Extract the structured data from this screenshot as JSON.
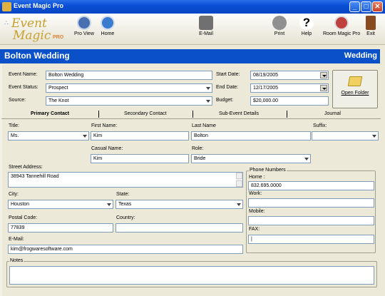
{
  "window": {
    "title": "Event Magic Pro"
  },
  "logo": {
    "line1": "Event",
    "line2": "Magic",
    "badge": "PRO"
  },
  "toolbar": {
    "pro_view": "Pro View",
    "home": "Home",
    "email": "E-Mail",
    "print": "Print",
    "help": "Help",
    "room_magic": "Room Magic Pro",
    "exit": "Exit"
  },
  "header": {
    "title": "Bolton Wedding",
    "type": "Wedding"
  },
  "form": {
    "event_name_label": "Event Name:",
    "event_name": "Bolton Wedding",
    "event_status_label": "Event Status:",
    "event_status": "Prospect",
    "source_label": "Source:",
    "source": "The Knot",
    "start_date_label": "Start Date:",
    "start_date": "08/19/2005",
    "end_date_label": "End Date:",
    "end_date": "12/17/2005",
    "budget_label": "Budget:",
    "budget": "$20,000.00",
    "open_folder": "Open Folder"
  },
  "tabs": [
    "Primary Contact",
    "Secondary Contact",
    "Sub-Event Details",
    "Journal"
  ],
  "contact": {
    "title_label": "Title:",
    "title": "Ms.",
    "first_name_label": "First Name:",
    "first_name": "Kim",
    "last_name_label": "Last Name",
    "last_name": "Bolton",
    "suffix_label": "Suffix:",
    "suffix": "",
    "casual_name_label": "Casual Name:",
    "casual_name": "Kim",
    "role_label": "Role:",
    "role": "Bride",
    "street_label": "Street Address:",
    "street": "38943 Tannehill Road",
    "city_label": "City:",
    "city": "Houston",
    "state_label": "State:",
    "state": "Texas",
    "postal_label": "Postal Code:",
    "postal": "77839",
    "country_label": "Country:",
    "country": "",
    "email_label": "E-Mail:",
    "email": "kim@frogwaresoftware.com",
    "phone_group": "Phone Numbers",
    "home_label": "Home :",
    "home": "832.695.0000",
    "work_label": "Work:",
    "work": "",
    "mobile_label": "Mobile:",
    "mobile": "",
    "fax_label": "FAX:",
    "fax": "|",
    "notes_label": "Notes",
    "notes": ""
  }
}
